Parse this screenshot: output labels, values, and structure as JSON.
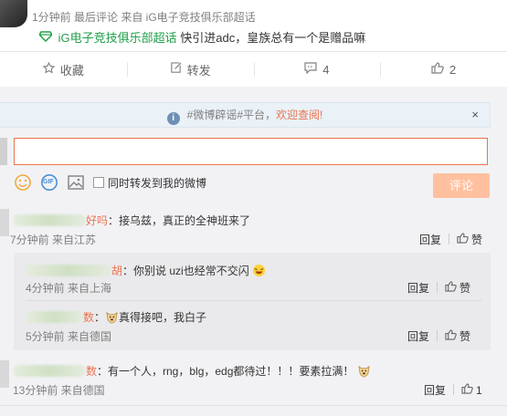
{
  "post_meta": {
    "line1": "1分钟前 最后评论 来自 iG电子竞技俱乐部超话",
    "supertopic_link": "iG电子竞技俱乐部超话",
    "supertopic_text": " 快引进adc，皇族总有一个是赠品嘛"
  },
  "actions": {
    "collect": "收藏",
    "forward": "转发",
    "comment_count": "4",
    "like_count": "2"
  },
  "notice": {
    "prefix": "#微博辟谣#平台，",
    "accent": "欢迎查阅!",
    "close": "×"
  },
  "composer": {
    "share_label": "同时转发到我的微博",
    "submit": "评论",
    "gif": "GIF"
  },
  "comments": [
    {
      "name_suffix": "好吗",
      "text": "：接乌兹，真正的全神班来了",
      "time": "7分钟前 来自江苏",
      "reply": "回复",
      "like": "赞"
    },
    {
      "name_suffix": "胡",
      "text": "：你别说 uzi也经常不交闪",
      "time": "4分钟前 来自上海",
      "reply": "回复",
      "like": "赞"
    },
    {
      "name_suffix": "数",
      "text": "真得接吧，我白子",
      "time": "5分钟前 来自德国",
      "reply": "回复",
      "like": "赞"
    },
    {
      "name_suffix": "数",
      "text": "：有一个人，rng，blg，edg都待过！！！要素拉满！",
      "time": "13分钟前 来自德国",
      "reply": "回复",
      "like": "1"
    }
  ],
  "colors": {
    "accent": "#eb7350",
    "super_green": "#1f9f49",
    "submit_disabled": "#ffc09f"
  },
  "icons": [
    "collect-icon",
    "forward-icon",
    "comment-icon",
    "like-icon",
    "info-icon",
    "close-icon",
    "emoji-icon",
    "gif-icon",
    "image-icon",
    "thumb-up-icon",
    "doge-emoji-icon",
    "laugh-emoji-icon"
  ]
}
